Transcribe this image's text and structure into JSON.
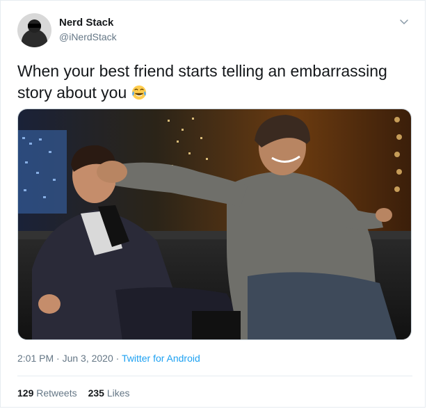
{
  "tweet": {
    "author_name": "Nerd Stack",
    "author_handle": "@iNerdStack",
    "text": "When your best friend starts telling an embarrassing story about you",
    "emoji": "face-with-tears-of-joy-icon",
    "timestamp": "2:01 PM · Jun 3, 2020 · ",
    "source": "Twitter for Android",
    "retweets_count": "129",
    "retweets_label": "Retweets",
    "likes_count": "235",
    "likes_label": "Likes"
  },
  "colors": {
    "link": "#1da1f2",
    "secondary_text": "#657786",
    "border": "#e6ecf0"
  }
}
